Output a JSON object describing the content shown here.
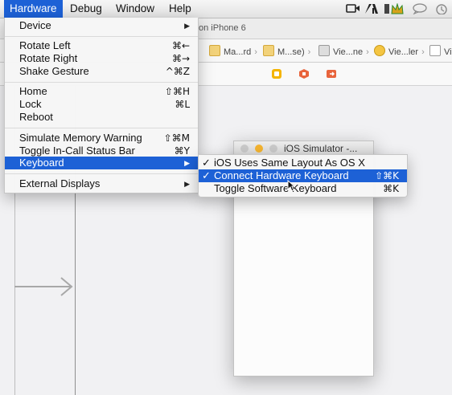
{
  "menubar": {
    "items": [
      "Hardware",
      "Debug",
      "Window",
      "Help"
    ],
    "status_icons": [
      "screen-record-icon",
      "adobe-icon",
      "crown-icon",
      "bluetooth-icon",
      "chat-icon",
      "time-machine-icon"
    ]
  },
  "toolbar": {
    "scheme_text": "on iPhone 6"
  },
  "jumpbar": {
    "crumbs": [
      "Ma...rd",
      "M...se)",
      "Vie...ne",
      "Vie...ler",
      "Vi"
    ]
  },
  "hardware_menu": {
    "items": [
      {
        "label": "Device",
        "shortcut": "",
        "submenu": true
      },
      {
        "label": "Rotate Left",
        "shortcut": "⌘←"
      },
      {
        "label": "Rotate Right",
        "shortcut": "⌘→"
      },
      {
        "label": "Shake Gesture",
        "shortcut": "^⌘Z"
      },
      {
        "label": "Home",
        "shortcut": "⇧⌘H"
      },
      {
        "label": "Lock",
        "shortcut": "⌘L"
      },
      {
        "label": "Reboot",
        "shortcut": ""
      },
      {
        "label": "Simulate Memory Warning",
        "shortcut": "⇧⌘M"
      },
      {
        "label": "Toggle In-Call Status Bar",
        "shortcut": "⌘Y"
      },
      {
        "label": "Keyboard",
        "shortcut": "",
        "submenu": true
      },
      {
        "label": "External Displays",
        "shortcut": "",
        "submenu": true
      }
    ]
  },
  "keyboard_submenu": {
    "items": [
      {
        "label": "iOS Uses Same Layout As OS X",
        "checked": "✓",
        "shortcut": ""
      },
      {
        "label": "Connect Hardware Keyboard",
        "checked": "✓",
        "shortcut": "⇧⌘K"
      },
      {
        "label": "Toggle Software Keyboard",
        "checked": "",
        "shortcut": "⌘K"
      }
    ]
  },
  "simulator": {
    "title": "iOS Simulator -..."
  },
  "colors": {
    "highlight": "#1d61d6",
    "menu_bg": "#f6f6f6"
  }
}
